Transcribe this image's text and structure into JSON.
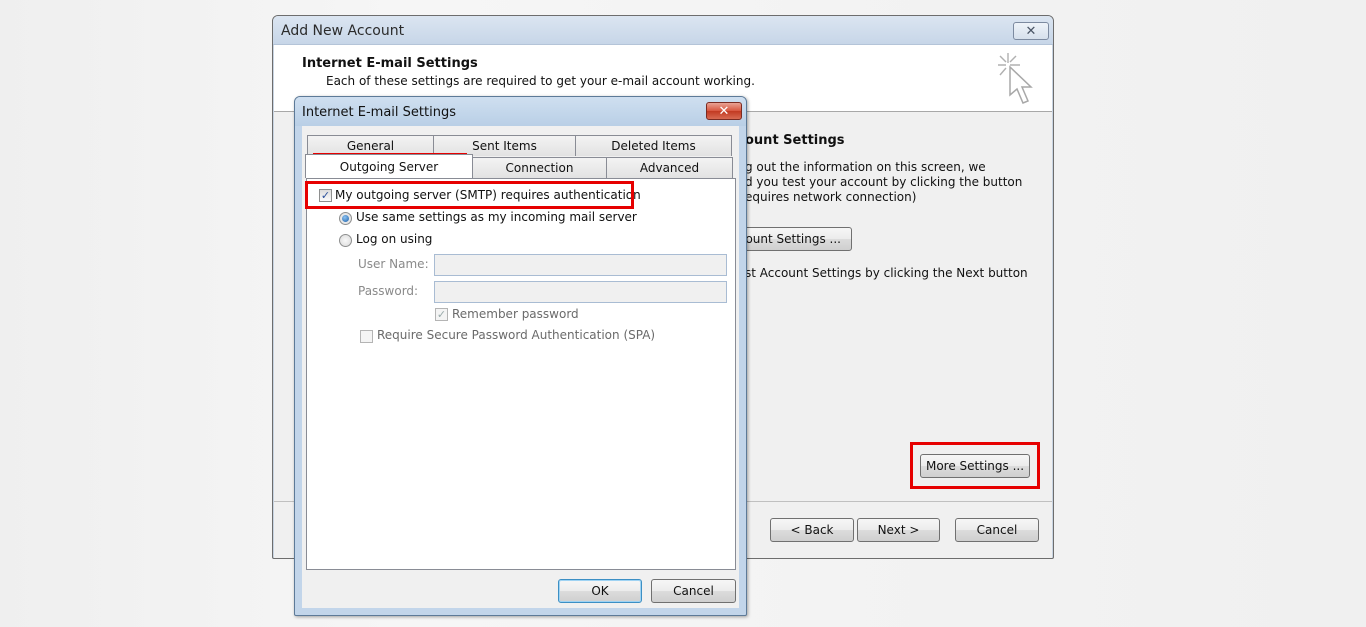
{
  "main_window": {
    "title": "Add New Account",
    "close_glyph": "✕",
    "header": {
      "title": "Internet E-mail Settings",
      "subtitle": "Each of these settings are required to get your e-mail account working.",
      "icon": "cursor-sparkle-icon"
    },
    "body": {
      "section_title": "ount Settings",
      "info_lines": [
        "g out the information on this screen, we",
        "d you test your account by clicking the button",
        "equires network connection)"
      ],
      "test_button_label": "count Settings ...",
      "next_hint": "st Account Settings by clicking the Next button",
      "more_settings_label": "More Settings ..."
    },
    "footer": {
      "back_label": "< Back",
      "next_label": "Next >",
      "cancel_label": "Cancel"
    }
  },
  "dialog": {
    "title": "Internet E-mail Settings",
    "close_glyph": "✕",
    "tabs_row1": [
      "General",
      "Sent Items",
      "Deleted Items"
    ],
    "tabs_row2": [
      "Outgoing Server",
      "Connection",
      "Advanced"
    ],
    "active_tab": "Outgoing Server",
    "smtp_auth": {
      "label": "My outgoing server (SMTP) requires authentication",
      "checked": true
    },
    "radio_same": {
      "label": "Use same settings as my incoming mail server",
      "selected": true
    },
    "radio_logon": {
      "label": "Log on using",
      "selected": false
    },
    "username": {
      "label": "User Name:",
      "value": ""
    },
    "password": {
      "label": "Password:",
      "value": ""
    },
    "remember_password": {
      "label": "Remember password",
      "checked": true
    },
    "spa": {
      "label": "Require Secure Password Authentication (SPA)",
      "checked": false
    },
    "ok_label": "OK",
    "cancel_label": "Cancel",
    "check_glyph": "✓"
  },
  "colors": {
    "highlight": "#e60000",
    "titlebar": "#c7d6e8",
    "close_red": "#c23a22"
  }
}
